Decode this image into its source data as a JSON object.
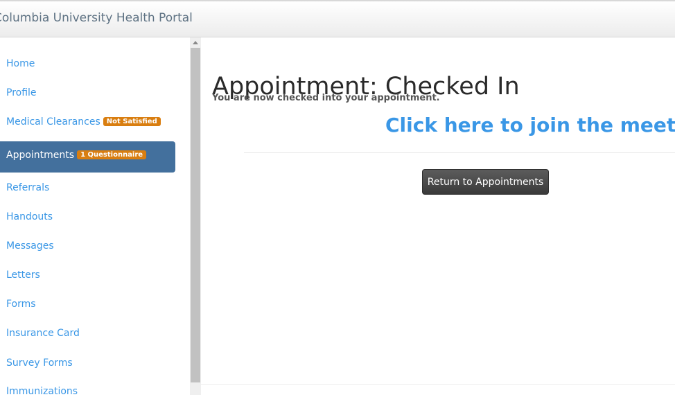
{
  "header": {
    "brand": "Columbia University Health Portal"
  },
  "sidebar": {
    "items": [
      {
        "label": "Home"
      },
      {
        "label": "Profile"
      },
      {
        "label": "Medical Clearances",
        "badge": "Not Satisfied"
      },
      {
        "label": "Appointments",
        "badge": "1 Questionnaire",
        "active": true
      },
      {
        "label": "Referrals"
      },
      {
        "label": "Handouts"
      },
      {
        "label": "Messages"
      },
      {
        "label": "Letters"
      },
      {
        "label": "Forms"
      },
      {
        "label": "Insurance Card"
      },
      {
        "label": "Survey Forms"
      },
      {
        "label": "Immunizations"
      }
    ]
  },
  "main": {
    "title": "Appointment: Checked In",
    "subtitle": "You are now checked into your appointment.",
    "join_link": "Click here to join the meeting.",
    "return_button": "Return to Appointments"
  },
  "colors": {
    "link": "#3a97e6",
    "active_bg": "#43709d",
    "badge": "#d97e10",
    "button": "#454545"
  }
}
